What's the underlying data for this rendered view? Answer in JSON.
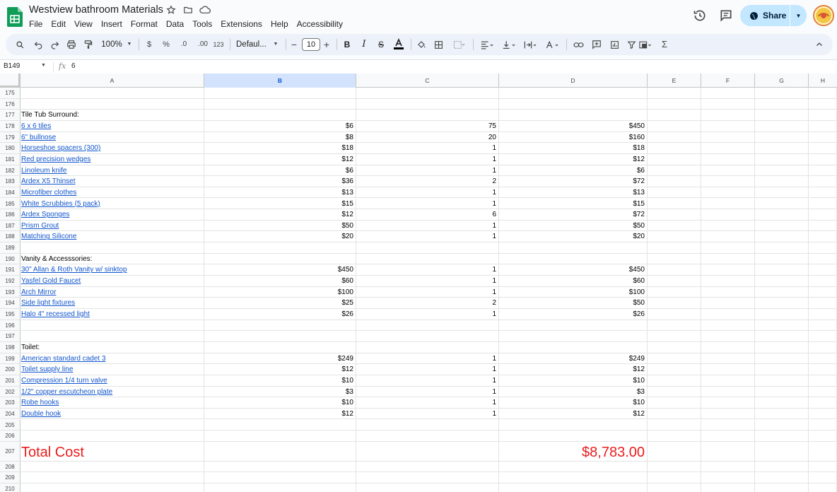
{
  "app": {
    "doc_title": "Westview bathroom Materials",
    "menu": [
      "File",
      "Edit",
      "View",
      "Insert",
      "Format",
      "Data",
      "Tools",
      "Extensions",
      "Help",
      "Accessibility"
    ],
    "share_label": "Share"
  },
  "toolbar": {
    "zoom": "100%",
    "currency": "$",
    "percent": "%",
    "dec_less": ".0",
    "dec_more": ".00",
    "more_formats": "123",
    "font": "Defaul...",
    "font_size": "10"
  },
  "formula_bar": {
    "cell_ref": "B149",
    "fx": "fx",
    "value": "6"
  },
  "columns": [
    "A",
    "B",
    "C",
    "D",
    "E",
    "F",
    "G",
    "H"
  ],
  "selected_column": "B",
  "rows": [
    {
      "n": "175",
      "a": "",
      "b": "",
      "c": "",
      "d": "",
      "link": false
    },
    {
      "n": "176",
      "a": "",
      "b": "",
      "c": "",
      "d": "",
      "link": false
    },
    {
      "n": "177",
      "a": "Tile Tub Surround:",
      "b": "",
      "c": "",
      "d": "",
      "link": false
    },
    {
      "n": "178",
      "a": "6 x 6 tiles ",
      "b": "$6",
      "c": "75",
      "d": "$450",
      "link": true
    },
    {
      "n": "179",
      "a": "6\" bullnose",
      "b": "$8",
      "c": "20",
      "d": "$160",
      "link": true
    },
    {
      "n": "180",
      "a": "Horseshoe spacers (300)",
      "b": "$18",
      "c": "1",
      "d": "$18",
      "link": true
    },
    {
      "n": "181",
      "a": "Red precision wedges",
      "b": "$12",
      "c": "1",
      "d": "$12",
      "link": true
    },
    {
      "n": "182",
      "a": "Linoleum knife",
      "b": "$6",
      "c": "1",
      "d": "$6",
      "link": true
    },
    {
      "n": "183",
      "a": "Ardex X5 Thinset",
      "b": "$36",
      "c": "2",
      "d": "$72",
      "link": true
    },
    {
      "n": "184",
      "a": "Microfiber clothes",
      "b": "$13",
      "c": "1",
      "d": "$13",
      "link": true
    },
    {
      "n": "185",
      "a": "White Scrubbies (5 pack)",
      "b": "$15",
      "c": "1",
      "d": "$15",
      "link": true
    },
    {
      "n": "186",
      "a": "Ardex Sponges",
      "b": "$12",
      "c": "6",
      "d": "$72",
      "link": true
    },
    {
      "n": "187",
      "a": "Prism Grout",
      "b": "$50",
      "c": "1",
      "d": "$50",
      "link": true
    },
    {
      "n": "188",
      "a": "Matching Silicone",
      "b": "$20",
      "c": "1",
      "d": "$20",
      "link": true
    },
    {
      "n": "189",
      "a": "",
      "b": "",
      "c": "",
      "d": "",
      "link": false
    },
    {
      "n": "190",
      "a": "Vanity & Accesssories:",
      "b": "",
      "c": "",
      "d": "",
      "link": false
    },
    {
      "n": "191",
      "a": "30\" Allan & Roth Vanity w/ sinktop",
      "b": "$450",
      "c": "1",
      "d": "$450",
      "link": true
    },
    {
      "n": "192",
      "a": "Yasfel Gold Faucet ",
      "b": "$60",
      "c": "1",
      "d": "$60",
      "link": true
    },
    {
      "n": "193",
      "a": "Arch Mirror",
      "b": "$100",
      "c": "1",
      "d": "$100",
      "link": true
    },
    {
      "n": "194",
      "a": "Side light fixtures",
      "b": "$25",
      "c": "2",
      "d": "$50",
      "link": true
    },
    {
      "n": "195",
      "a": "Halo 4\" recessed light",
      "b": "$26",
      "c": "1",
      "d": "$26",
      "link": true
    },
    {
      "n": "196",
      "a": "",
      "b": "",
      "c": "",
      "d": "",
      "link": false
    },
    {
      "n": "197",
      "a": "",
      "b": "",
      "c": "",
      "d": "",
      "link": false
    },
    {
      "n": "198",
      "a": "Toilet:",
      "b": "",
      "c": "",
      "d": "",
      "link": false
    },
    {
      "n": "199",
      "a": "American standard cadet 3",
      "b": "$249",
      "c": "1",
      "d": "$249",
      "link": true
    },
    {
      "n": "200",
      "a": "Toilet supply line ",
      "b": "$12",
      "c": "1",
      "d": "$12",
      "link": true
    },
    {
      "n": "201",
      "a": "Compression 1/4 turn valve",
      "b": "$10",
      "c": "1",
      "d": "$10",
      "link": true
    },
    {
      "n": "202",
      "a": "1/2\" copper escutcheon plate ",
      "b": "$3",
      "c": "1",
      "d": "$3",
      "link": true
    },
    {
      "n": "203",
      "a": "Robe hooks",
      "b": "$10",
      "c": "1",
      "d": "$10",
      "link": true
    },
    {
      "n": "204",
      "a": "Double hook",
      "b": "$12",
      "c": "1",
      "d": "$12",
      "link": true
    },
    {
      "n": "205",
      "a": "",
      "b": "",
      "c": "",
      "d": "",
      "link": false
    },
    {
      "n": "206",
      "a": "",
      "b": "",
      "c": "",
      "d": "",
      "link": false
    },
    {
      "n": "207",
      "a": "Total Cost",
      "b": "",
      "c": "",
      "d": "$8,783.00",
      "link": false,
      "big": true
    },
    {
      "n": "208",
      "a": "",
      "b": "",
      "c": "",
      "d": "",
      "link": false
    },
    {
      "n": "209",
      "a": "",
      "b": "",
      "c": "",
      "d": "",
      "link": false
    },
    {
      "n": "210",
      "a": "",
      "b": "",
      "c": "",
      "d": "",
      "link": false
    }
  ],
  "colors": {
    "link": "#1155cc",
    "total": "#ea1c1c",
    "share_bg": "#c2e7ff",
    "selected_header": "#d3e3fd"
  }
}
